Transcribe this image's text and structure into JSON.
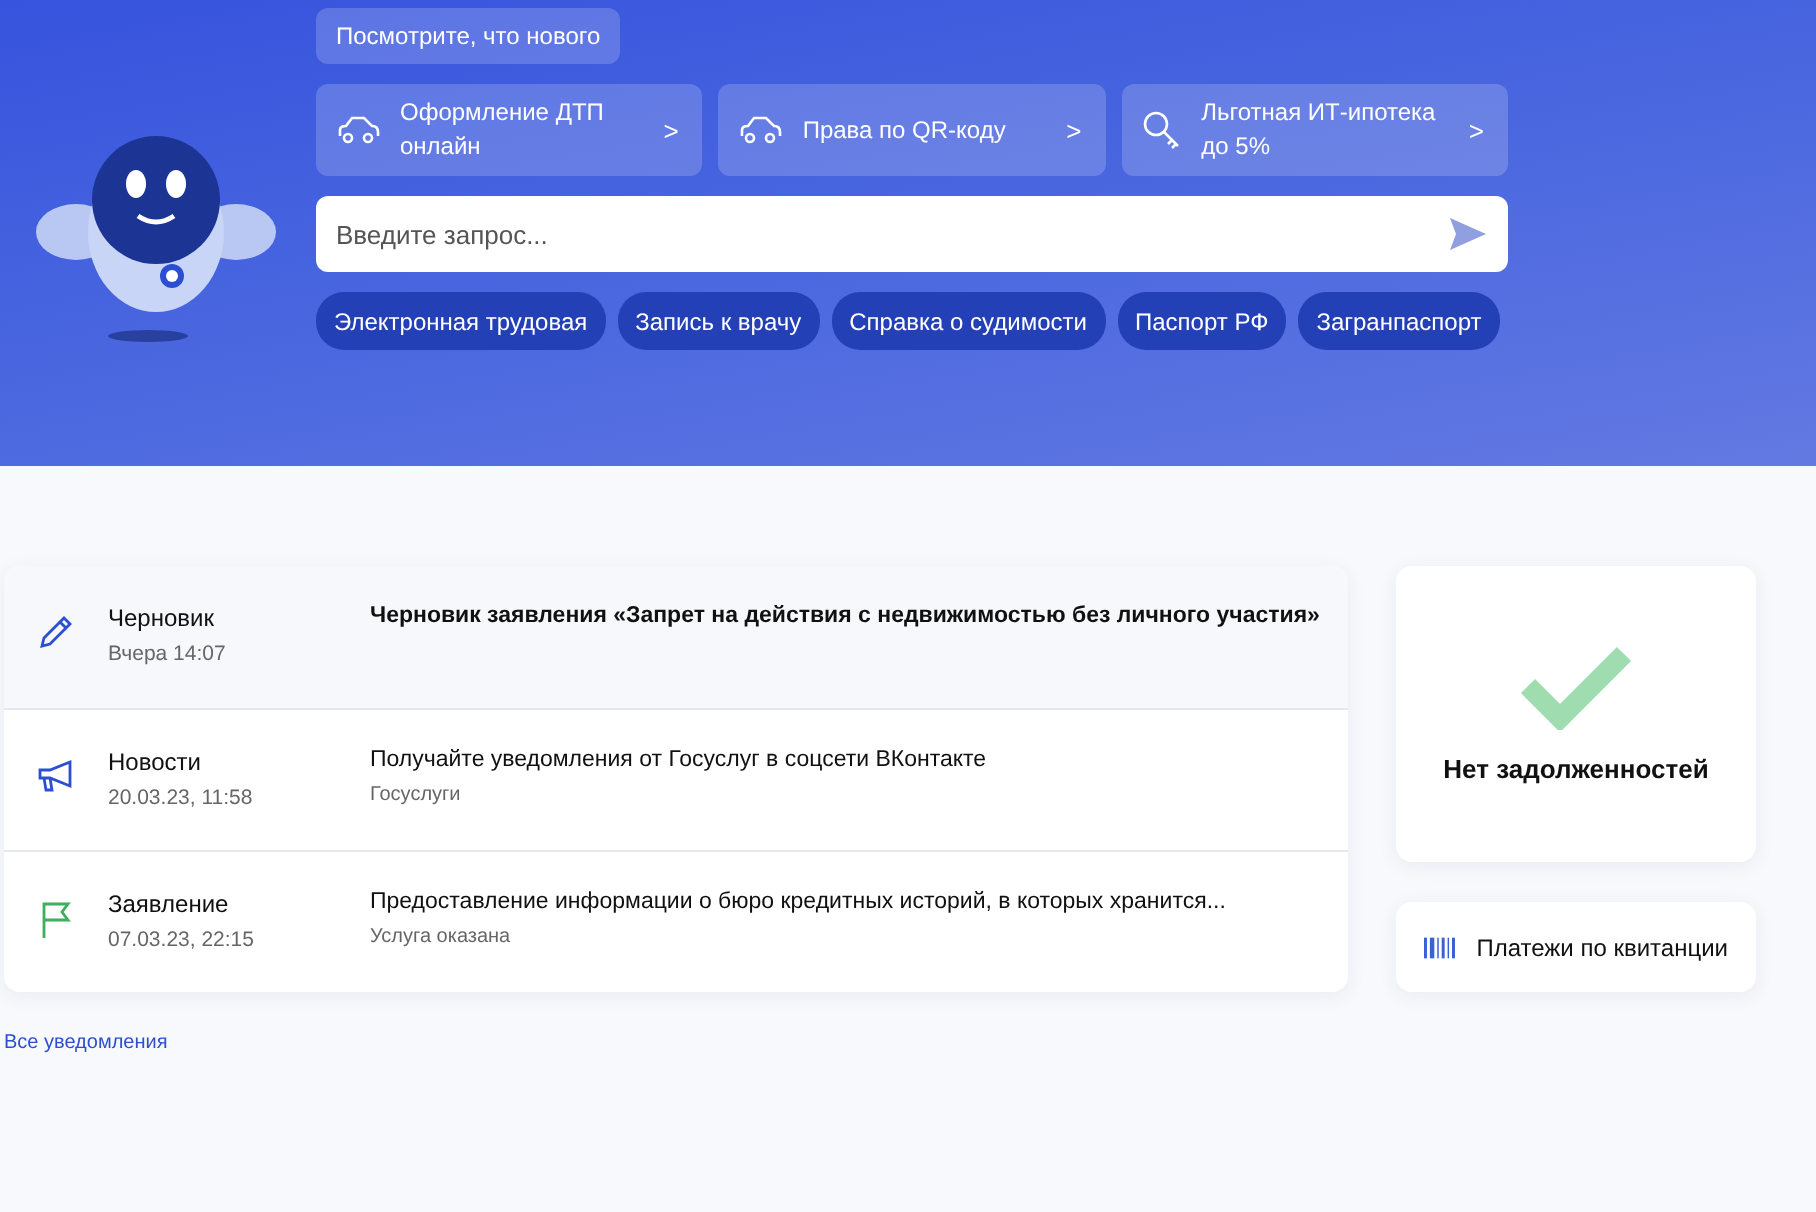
{
  "header": {
    "whats_new": "Посмотрите, что нового",
    "shortcuts": [
      {
        "kind": "car",
        "label": "Оформление ДТП онлайн",
        "chevron": ">"
      },
      {
        "kind": "car",
        "label": "Права по QR-коду",
        "chevron": ">"
      },
      {
        "kind": "key",
        "label": "Льготная ИТ-ипотека до 5%",
        "chevron": ">"
      }
    ],
    "search": {
      "placeholder": "Введите запрос..."
    },
    "chips": [
      "Электронная трудовая",
      "Запись к врачу",
      "Справка о судимости",
      "Паспорт РФ",
      "Загранпаспорт"
    ]
  },
  "notifications": [
    {
      "kind": "draft",
      "type": "Черновик",
      "date": "Вчера 14:07",
      "title": "Черновик заявления «Запрет на действия с недвижимостью без личного участия»",
      "unread": true
    },
    {
      "kind": "news",
      "type": "Новости",
      "date": "20.03.23, 11:58",
      "title": "Получайте уведомления от Госуслуг в соцсети ВКонтакте",
      "subtitle": "Госуслуги",
      "unread": false
    },
    {
      "kind": "application",
      "type": "Заявление",
      "date": "07.03.23, 22:15",
      "title": "Предоставление информации о бюро кредитных историй, в которых хранится...",
      "subtitle": "Услуга оказана",
      "unread": false
    }
  ],
  "all_notifications": "Все уведомления",
  "debts": {
    "status": "Нет задолженностей"
  },
  "payments": {
    "label": "Платежи по квитанции"
  }
}
